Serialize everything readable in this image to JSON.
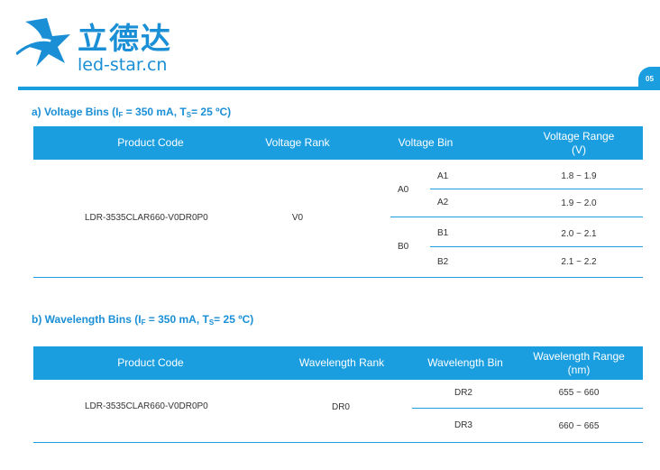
{
  "header": {
    "logo_cn": "立德达",
    "logo_en": "led-star.cn",
    "page_number": "05",
    "brand_color": "#1a9ee0"
  },
  "voltage_section": {
    "title_prefix": "a)  Voltage Bins (I",
    "title_sub1": "F",
    "title_mid": " = 350 mA, T",
    "title_sub2": "S",
    "title_suffix": "= 25 ºC)",
    "headers": {
      "product_code": "Product Code",
      "rank": "Voltage Rank",
      "bin": "Voltage Bin",
      "range_line1": "Voltage Range",
      "range_line2": "(V)"
    },
    "product_code": "LDR-3535CLAR660-V0DR0P0",
    "rank": "V0",
    "groups": [
      {
        "group": "A0",
        "bins": [
          {
            "bin": "A1",
            "range": "1.8 ~ 1.9"
          },
          {
            "bin": "A2",
            "range": "1.9 ~ 2.0"
          }
        ]
      },
      {
        "group": "B0",
        "bins": [
          {
            "bin": "B1",
            "range": "2.0 ~ 2.1"
          },
          {
            "bin": "B2",
            "range": "2.1 ~ 2.2"
          }
        ]
      }
    ]
  },
  "wavelength_section": {
    "title_prefix": "b) Wavelength Bins (I",
    "title_sub1": "F",
    "title_mid": " = 350 mA, T",
    "title_sub2": "S",
    "title_suffix": "= 25 ºC)",
    "headers": {
      "product_code": "Product Code",
      "rank": "Wavelength Rank",
      "bin": "Wavelength Bin",
      "range_line1": "Wavelength Range",
      "range_line2": "(nm)"
    },
    "product_code": "LDR-3535CLAR660-V0DR0P0",
    "rank": "DR0",
    "bins": [
      {
        "bin": "DR2",
        "range": "655 ~ 660"
      },
      {
        "bin": "DR3",
        "range": "660 ~ 665"
      }
    ]
  }
}
